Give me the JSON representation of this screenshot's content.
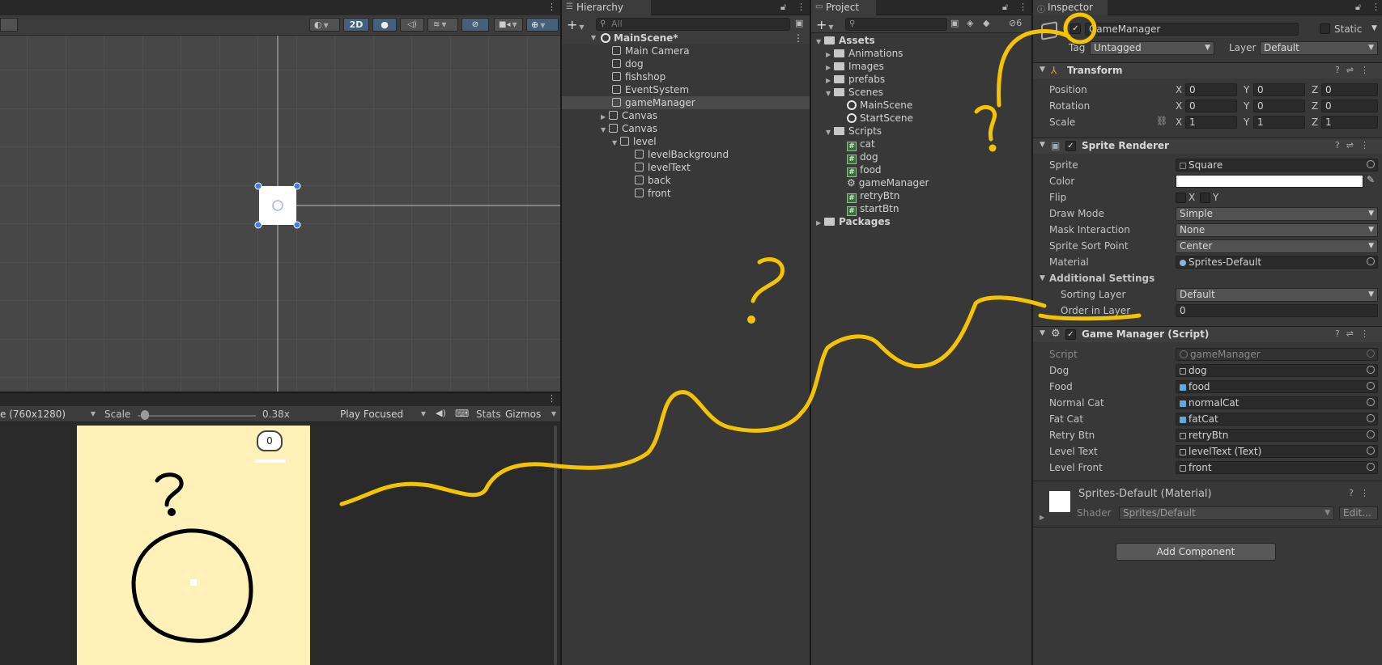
{
  "scene_view": {
    "toolbar": {
      "mode_2d": "2D"
    }
  },
  "game_view": {
    "resolution": "e (760x1280)",
    "scale_label": "Scale",
    "scale_value": "0.38x",
    "play_mode": "Play Focused",
    "stats": "Stats",
    "gizmos": "Gizmos",
    "score": "0"
  },
  "hierarchy": {
    "tab": "Hierarchy",
    "search_placeholder": "All",
    "scene": "MainScene*",
    "items": [
      {
        "label": "Main Camera"
      },
      {
        "label": "dog"
      },
      {
        "label": "fishshop"
      },
      {
        "label": "EventSystem"
      },
      {
        "label": "gameManager"
      },
      {
        "label": "Canvas"
      },
      {
        "label": "Canvas"
      },
      {
        "label": "level"
      },
      {
        "label": "levelBackground"
      },
      {
        "label": "levelText"
      },
      {
        "label": "back"
      },
      {
        "label": "front"
      }
    ]
  },
  "project": {
    "tab": "Project",
    "hidden_count": "6",
    "tree": [
      {
        "label": "Assets"
      },
      {
        "label": "Animations"
      },
      {
        "label": "Images"
      },
      {
        "label": "prefabs"
      },
      {
        "label": "Scenes"
      },
      {
        "label": "MainScene"
      },
      {
        "label": "StartScene"
      },
      {
        "label": "Scripts"
      },
      {
        "label": "cat"
      },
      {
        "label": "dog"
      },
      {
        "label": "food"
      },
      {
        "label": "gameManager"
      },
      {
        "label": "retryBtn"
      },
      {
        "label": "startBtn"
      },
      {
        "label": "Packages"
      }
    ]
  },
  "inspector": {
    "tab": "Inspector",
    "object_name": "GameManager",
    "static_label": "Static",
    "tag_label": "Tag",
    "tag_value": "Untagged",
    "layer_label": "Layer",
    "layer_value": "Default",
    "transform": {
      "title": "Transform",
      "position_label": "Position",
      "rotation_label": "Rotation",
      "scale_label": "Scale",
      "x": "X",
      "y": "Y",
      "z": "Z",
      "position": [
        "0",
        "0",
        "0"
      ],
      "rotation": [
        "0",
        "0",
        "0"
      ],
      "scale": [
        "1",
        "1",
        "1"
      ]
    },
    "sprite_renderer": {
      "title": "Sprite Renderer",
      "sprite_label": "Sprite",
      "sprite_value": "Square",
      "color_label": "Color",
      "flip_label": "Flip",
      "flip_x": "X",
      "flip_y": "Y",
      "draw_mode_label": "Draw Mode",
      "draw_mode_value": "Simple",
      "mask_label": "Mask Interaction",
      "mask_value": "None",
      "sort_point_label": "Sprite Sort Point",
      "sort_point_value": "Center",
      "material_label": "Material",
      "material_value": "Sprites-Default",
      "additional_label": "Additional Settings",
      "sorting_layer_label": "Sorting Layer",
      "sorting_layer_value": "Default",
      "order_label": "Order in Layer",
      "order_value": "0"
    },
    "game_manager": {
      "title": "Game Manager (Script)",
      "fields": [
        {
          "label": "Script",
          "value": "gameManager"
        },
        {
          "label": "Dog",
          "value": "dog"
        },
        {
          "label": "Food",
          "value": "food"
        },
        {
          "label": "Normal Cat",
          "value": "normalCat"
        },
        {
          "label": "Fat Cat",
          "value": "fatCat"
        },
        {
          "label": "Retry Btn",
          "value": "retryBtn"
        },
        {
          "label": "Level Text",
          "value": "levelText (Text)"
        },
        {
          "label": "Level Front",
          "value": "front"
        }
      ]
    },
    "material": {
      "title": "Sprites-Default (Material)",
      "shader_label": "Shader",
      "shader_value": "Sprites/Default",
      "edit": "Edit..."
    },
    "add_component": "Add Component"
  },
  "colors": {
    "annotation": "#f5c400",
    "game_bg": "#fff1b8",
    "panel": "#383838"
  }
}
